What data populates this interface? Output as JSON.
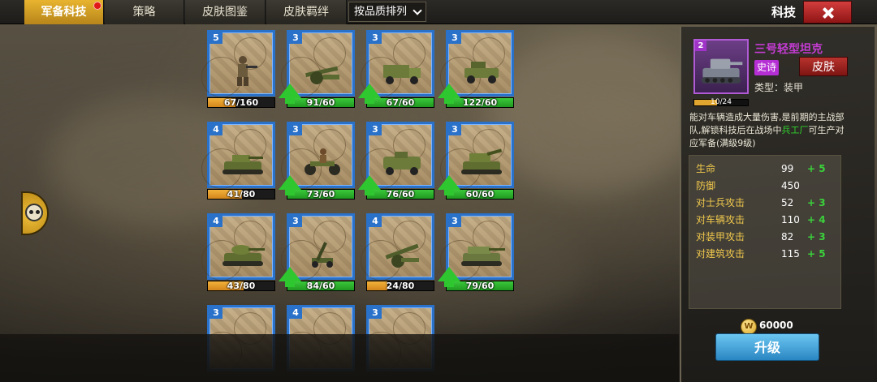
{
  "tabs": [
    {
      "label": "军备科技",
      "active": true,
      "has_dot": true
    },
    {
      "label": "策略",
      "active": false
    },
    {
      "label": "皮肤图鉴",
      "active": false
    },
    {
      "label": "皮肤羁绊",
      "active": false
    }
  ],
  "sort": {
    "label": "按品质排列"
  },
  "header": {
    "title": "科技"
  },
  "cards": [
    {
      "level": "5",
      "progress": "67/160",
      "fill": 0.42,
      "color": "orange",
      "upgradable": false,
      "unit": "soldier"
    },
    {
      "level": "3",
      "progress": "91/60",
      "fill": 1,
      "color": "green",
      "upgradable": true,
      "unit": "cannon"
    },
    {
      "level": "3",
      "progress": "67/60",
      "fill": 1,
      "color": "green",
      "upgradable": true,
      "unit": "truck"
    },
    {
      "level": "3",
      "progress": "122/60",
      "fill": 1,
      "color": "green",
      "upgradable": true,
      "unit": "jeep"
    },
    {
      "level": "4",
      "progress": "41/80",
      "fill": 0.51,
      "color": "orange",
      "upgradable": false,
      "unit": "light-tank"
    },
    {
      "level": "3",
      "progress": "73/60",
      "fill": 1,
      "color": "green",
      "upgradable": true,
      "unit": "motorcycle"
    },
    {
      "level": "3",
      "progress": "76/60",
      "fill": 1,
      "color": "green",
      "upgradable": true,
      "unit": "armored-car"
    },
    {
      "level": "3",
      "progress": "60/60",
      "fill": 1,
      "color": "green",
      "upgradable": true,
      "unit": "spg"
    },
    {
      "level": "4",
      "progress": "43/80",
      "fill": 0.54,
      "color": "orange",
      "upgradable": false,
      "unit": "medium-tank"
    },
    {
      "level": "3",
      "progress": "84/60",
      "fill": 1,
      "color": "green",
      "upgradable": true,
      "unit": "aa-gun"
    },
    {
      "level": "4",
      "progress": "24/80",
      "fill": 0.3,
      "color": "orange",
      "upgradable": false,
      "unit": "howitzer"
    },
    {
      "level": "3",
      "progress": "79/60",
      "fill": 1,
      "color": "green",
      "upgradable": true,
      "unit": "tank-destroyer"
    },
    {
      "level": "3",
      "progress": "",
      "fill": 0,
      "color": "green",
      "upgradable": false,
      "unit": "unknown"
    },
    {
      "level": "4",
      "progress": "",
      "fill": 0,
      "color": "green",
      "upgradable": false,
      "unit": "unknown"
    },
    {
      "level": "3",
      "progress": "",
      "fill": 0,
      "color": "green",
      "upgradable": false,
      "unit": "unknown"
    }
  ],
  "panel": {
    "portrait_level": "2",
    "name": "三号轻型坦克",
    "rarity": "史诗",
    "skin_button": "皮肤",
    "type_label": "类型：装甲",
    "progress": "10/24",
    "progress_fill": 0.42,
    "desc_before": "能对车辆造成大量伤害,是前期的主战部队,解锁科技后在战场中",
    "desc_highlight": "兵工厂",
    "desc_after": "可生产对应军备(满级9级)",
    "stats": [
      {
        "name": "生命",
        "value": "99",
        "bonus": "+ 5"
      },
      {
        "name": "防御",
        "value": "450",
        "bonus": ""
      },
      {
        "name": "对士兵攻击",
        "value": "52",
        "bonus": "+ 3"
      },
      {
        "name": "对车辆攻击",
        "value": "110",
        "bonus": "+ 4"
      },
      {
        "name": "对装甲攻击",
        "value": "82",
        "bonus": "+ 3"
      },
      {
        "name": "对建筑攻击",
        "value": "115",
        "bonus": "+ 5"
      }
    ],
    "cost": "60000",
    "upgrade_button": "升级"
  },
  "colors": {
    "accent": "#e8b42f",
    "card_border": "#2a71c9",
    "epic": "#b52fd4",
    "green": "#2fc72f"
  }
}
